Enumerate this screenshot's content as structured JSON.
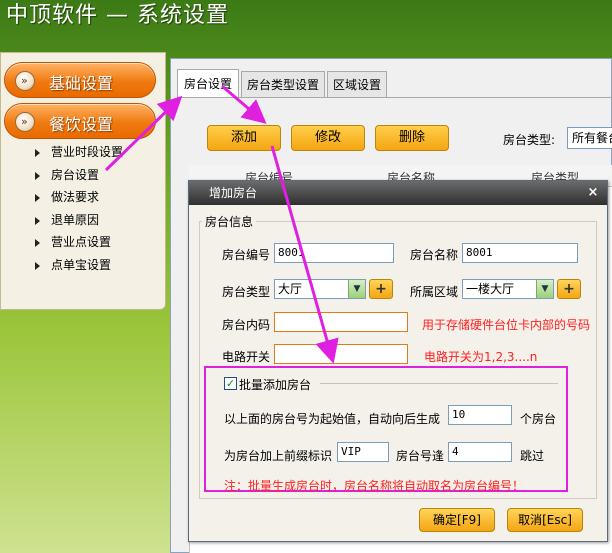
{
  "app": {
    "title": "中顶软件 — 系统设置"
  },
  "sidebar": {
    "top_items": [
      {
        "label": "基础设置"
      },
      {
        "label": "餐饮设置"
      }
    ],
    "sub_items": [
      {
        "label": "营业时段设置"
      },
      {
        "label": "房台设置"
      },
      {
        "label": "做法要求"
      },
      {
        "label": "退单原因"
      },
      {
        "label": "营业点设置"
      },
      {
        "label": "点单宝设置"
      }
    ]
  },
  "tabs": [
    {
      "label": "房台设置",
      "active": true
    },
    {
      "label": "房台类型设置",
      "active": false
    },
    {
      "label": "区域设置",
      "active": false
    }
  ],
  "toolbar": {
    "add_label": "添加",
    "edit_label": "修改",
    "delete_label": "删除",
    "type_label": "房台类型:",
    "type_value": "所有餐台"
  },
  "grid": {
    "columns": [
      "房台编号",
      "房台名称",
      "房台类型"
    ]
  },
  "dialog": {
    "title": "增加房台",
    "close_glyph": "×",
    "group_title": "房台信息",
    "room_no_label": "房台编号",
    "room_no_value": "8001",
    "room_name_label": "房台名称",
    "room_name_value": "8001",
    "room_type_label": "房台类型",
    "room_type_value": "大厅",
    "area_label": "所属区域",
    "area_value": "一楼大厅",
    "plus_glyph": "+",
    "inner_code_label": "房台内码",
    "inner_code_value": "",
    "inner_code_hint": "用于存储硬件台位卡内部的号码",
    "circuit_label": "电路开关",
    "circuit_value": "",
    "circuit_hint": "电路开关为1,2,3....n",
    "batch": {
      "checked": true,
      "label": "批量添加房台",
      "gen_prefix": "以上面的房台号为起始值，自动向后生成",
      "count_value": "10",
      "count_suffix": "个房台",
      "prefix_label": "为房台加上前缀标识",
      "prefix_value": "VIP",
      "skip_label": "房台号逢",
      "skip_value": "4",
      "skip_suffix": "跳过",
      "note": "注：批量生成房台时，房台名称将自动取名为房台编号！"
    },
    "ok_label": "确定[F9]",
    "cancel_label": "取消[Esc]"
  },
  "colors": {
    "annotation": "#e020e0",
    "accent_orange": "#f07a10",
    "button_gold": "#f4a512",
    "hint_red": "#ff2020"
  }
}
